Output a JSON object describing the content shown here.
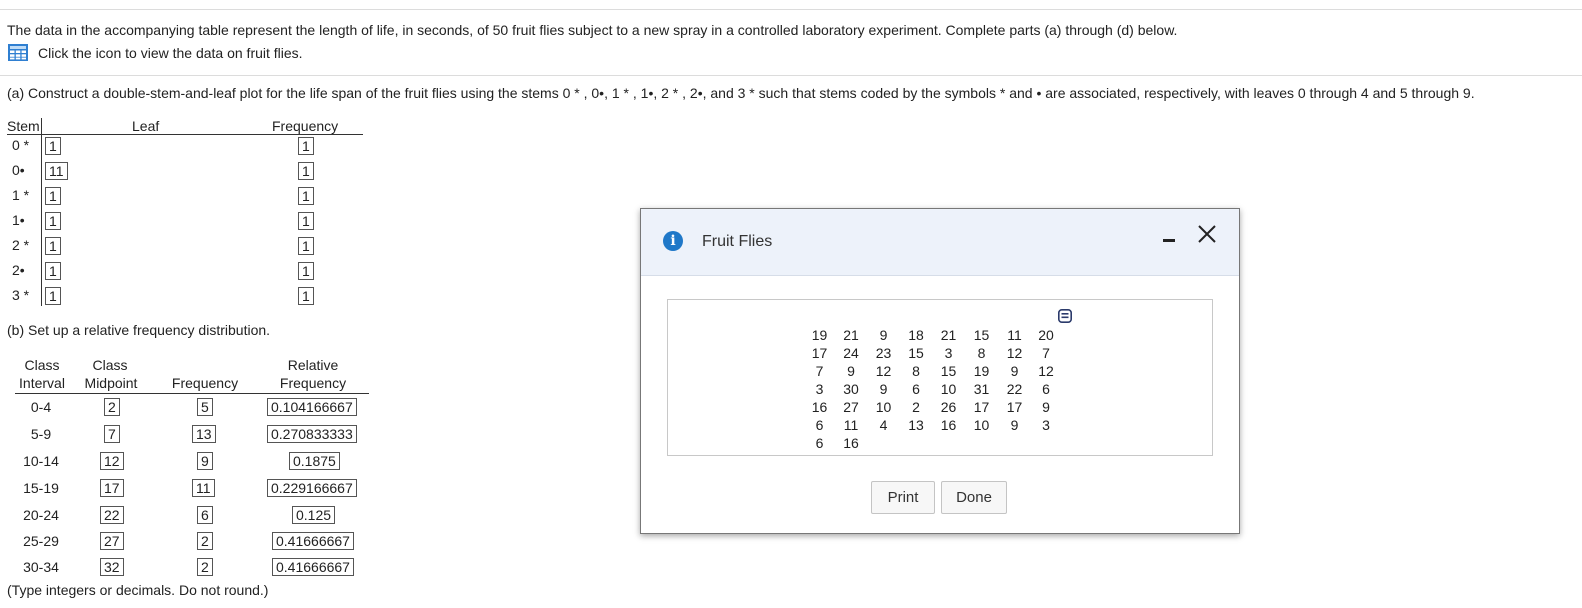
{
  "intro": "The data in the accompanying table represent the length of life, in seconds, of 50 fruit flies subject to a new spray in a controlled laboratory experiment. Complete parts (a) through (d) below.",
  "view_data_link": "Click the icon to view the data on fruit flies.",
  "part_a": {
    "prompt": "(a) Construct a double-stem-and-leaf plot for the life span of the fruit flies using the stems 0 * , 0•, 1 * , 1•, 2 * , 2•, and 3 *  such that stems coded by the symbols  *  and • are associated, respectively, with leaves 0 through 4 and 5 through 9.",
    "headers": {
      "stem": "Stem",
      "leaf": "Leaf",
      "frequency": "Frequency"
    },
    "rows": [
      {
        "stem": "0 *",
        "leaf": "1",
        "frequency": "1"
      },
      {
        "stem": "0•",
        "leaf": "11",
        "frequency": "1"
      },
      {
        "stem": "1 *",
        "leaf": "1",
        "frequency": "1"
      },
      {
        "stem": "1•",
        "leaf": "1",
        "frequency": "1"
      },
      {
        "stem": "2 *",
        "leaf": "1",
        "frequency": "1"
      },
      {
        "stem": "2•",
        "leaf": "1",
        "frequency": "1"
      },
      {
        "stem": "3 *",
        "leaf": "1",
        "frequency": "1"
      }
    ]
  },
  "part_b": {
    "prompt": "(b) Set up a relative frequency distribution.",
    "headers": {
      "class_line1": "Class",
      "interval": "Interval",
      "midpoint_line1": "Class",
      "midpoint": "Midpoint",
      "frequency": "Frequency",
      "relative": "Relative",
      "relative_line2": "Frequency"
    },
    "rows": [
      {
        "interval": "0-4",
        "midpoint": "2",
        "frequency": "5",
        "relative": "0.104166667"
      },
      {
        "interval": "5-9",
        "midpoint": "7",
        "frequency": "13",
        "relative": "0.270833333"
      },
      {
        "interval": "10-14",
        "midpoint": "12",
        "frequency": "9",
        "relative": "0.1875"
      },
      {
        "interval": "15-19",
        "midpoint": "17",
        "frequency": "11",
        "relative": "0.229166667"
      },
      {
        "interval": "20-24",
        "midpoint": "22",
        "frequency": "6",
        "relative": "0.125"
      },
      {
        "interval": "25-29",
        "midpoint": "27",
        "frequency": "2",
        "relative": "0.41666667"
      },
      {
        "interval": "30-34",
        "midpoint": "32",
        "frequency": "2",
        "relative": "0.41666667"
      }
    ],
    "note": "(Type integers or decimals. Do not round.)"
  },
  "dialog": {
    "title": "Fruit Flies",
    "data_rows": [
      [
        "19",
        "21",
        "9",
        "18",
        "21",
        "15",
        "11",
        "20"
      ],
      [
        "17",
        "24",
        "23",
        "15",
        "3",
        "8",
        "12",
        "7"
      ],
      [
        "7",
        "9",
        "12",
        "8",
        "15",
        "19",
        "9",
        "12"
      ],
      [
        "3",
        "30",
        "9",
        "6",
        "10",
        "31",
        "22",
        "6"
      ],
      [
        "16",
        "27",
        "10",
        "2",
        "26",
        "17",
        "17",
        "9"
      ],
      [
        "6",
        "11",
        "4",
        "13",
        "16",
        "10",
        "9",
        "3"
      ],
      [
        "6",
        "16",
        "",
        "",
        "",
        "",
        "",
        ""
      ]
    ],
    "print_label": "Print",
    "done_label": "Done"
  },
  "colors": {
    "accent": "#1f78c8",
    "header_bg": "#edf2fa"
  }
}
